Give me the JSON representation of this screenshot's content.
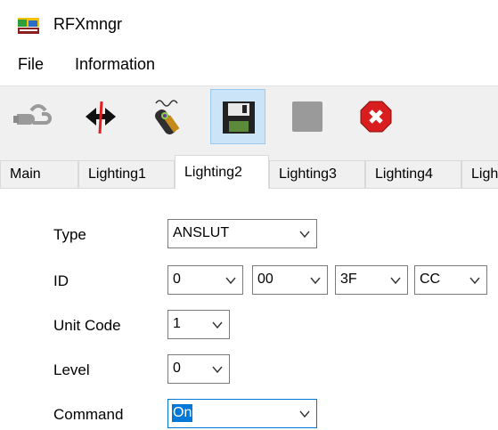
{
  "window": {
    "title": "RFXmngr"
  },
  "menu": {
    "items": [
      "File",
      "Information"
    ]
  },
  "toolbar": {
    "buttons": [
      {
        "icon": "disconnect-plug-icon"
      },
      {
        "icon": "connect-arrows-icon"
      },
      {
        "icon": "rfx-receiver-icon"
      },
      {
        "icon": "floppy-save-icon"
      },
      {
        "icon": "gray-square-icon"
      },
      {
        "icon": "red-x-close-icon"
      }
    ]
  },
  "tabs": [
    "Main",
    "Lighting1",
    "Lighting2",
    "Lighting3",
    "Lighting4",
    "Light"
  ],
  "active_tab": "Lighting2",
  "form": {
    "type": {
      "label": "Type",
      "value": "ANSLUT"
    },
    "id": {
      "label": "ID",
      "values": [
        "0",
        "00",
        "3F",
        "CC"
      ]
    },
    "unit_code": {
      "label": "Unit Code",
      "value": "1"
    },
    "level": {
      "label": "Level",
      "value": "0"
    },
    "command": {
      "label": "Command",
      "value": "On"
    }
  },
  "colors": {
    "selection": "#0078d7",
    "toolbar_bg": "#f0f0f0",
    "pressed": "#cce4f7"
  }
}
